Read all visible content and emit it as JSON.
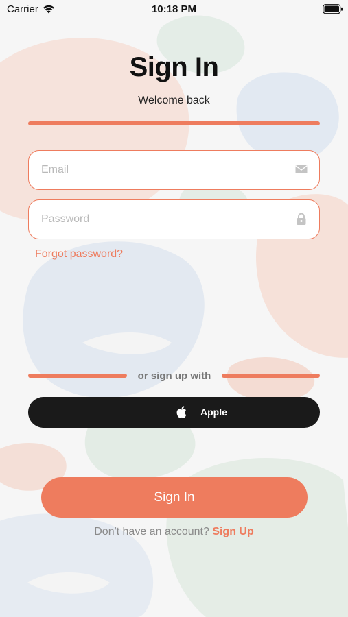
{
  "status_bar": {
    "carrier": "Carrier",
    "time": "10:18 PM"
  },
  "header": {
    "title": "Sign In",
    "subtitle": "Welcome back"
  },
  "form": {
    "email_placeholder": "Email",
    "password_placeholder": "Password",
    "forgot_password": "Forgot password?"
  },
  "social": {
    "divider_text": "or sign up with",
    "apple_label": "Apple"
  },
  "actions": {
    "sign_in_label": "Sign In",
    "signup_prompt": "Don't have an account?",
    "signup_link": "Sign Up"
  },
  "icons": {
    "wifi": "wifi-icon",
    "battery": "battery-icon",
    "email": "envelope-icon",
    "password": "lock-icon",
    "apple": "apple-logo-icon"
  },
  "colors": {
    "accent": "#ee7c5e",
    "apple_button": "#1a1a1a",
    "background": "#f6f6f6"
  }
}
